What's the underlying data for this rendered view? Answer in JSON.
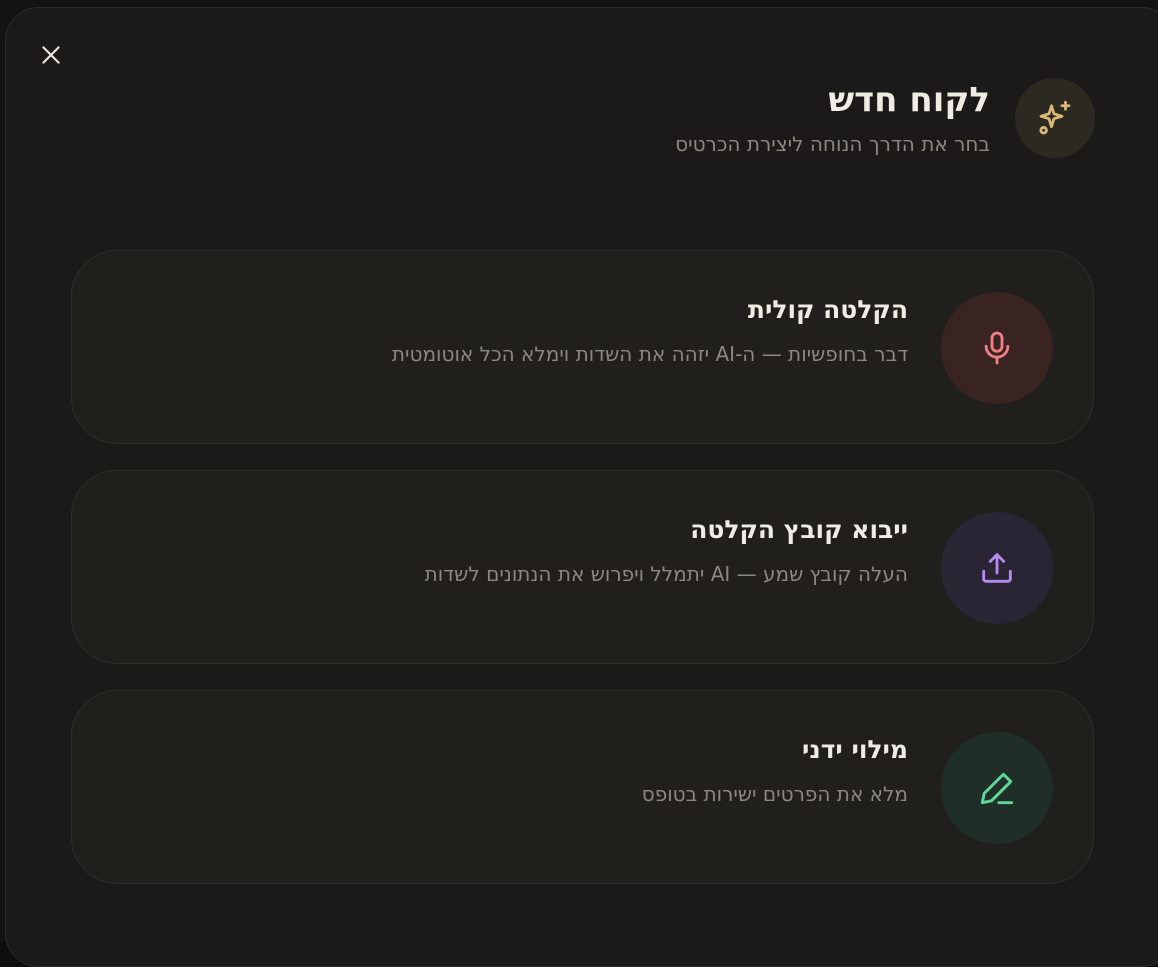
{
  "header": {
    "title": "לקוח חדש",
    "subtitle": "בחר את הדרך הנוחה ליצירת הכרטיס",
    "icon": "sparkles-icon"
  },
  "close": {
    "icon": "close-icon"
  },
  "options": [
    {
      "title": "הקלטה קולית",
      "description": "דבר בחופשיות — ה-AI יזהה את השדות וימלא הכל אוטומטית",
      "icon": "microphone-icon",
      "icon_bg": "#3a2422",
      "icon_color": "#f07f86"
    },
    {
      "title": "ייבוא קובץ הקלטה",
      "description": "העלה קובץ שמע — AI יתמלל ויפרוש את הנתונים לשדות",
      "icon": "upload-icon",
      "icon_bg": "#2a2535",
      "icon_color": "#b58af5"
    },
    {
      "title": "מילוי ידני",
      "description": "מלא את הפרטים ישירות בטופס",
      "icon": "pencil-icon",
      "icon_bg": "#1f2f27",
      "icon_color": "#5fd79a"
    }
  ],
  "colors": {
    "accent_gold": "#d9b877",
    "modal_bg": "#1c1a18",
    "card_bg": "#201f1c"
  }
}
